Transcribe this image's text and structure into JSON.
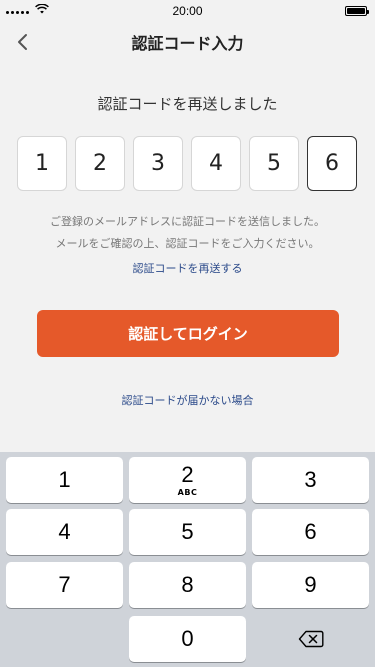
{
  "status_bar": {
    "time": "20:00"
  },
  "nav": {
    "title": "認証コード入力"
  },
  "headline": "認証コードを再送しました",
  "code_digits": [
    "1",
    "2",
    "3",
    "4",
    "5",
    "6"
  ],
  "message": {
    "line1": "ご登録のメールアドレスに認証コードを送信しました。",
    "line2": "メールをご確認の上、認証コードをご入力ください。"
  },
  "resend_link": "認証コードを再送する",
  "login_button": "認証してログイン",
  "help_link": "認証コードが届かない場合",
  "keypad": {
    "k1": "1",
    "k2": "2",
    "k2_sub": "ABC",
    "k3": "3",
    "k4": "4",
    "k5": "5",
    "k6": "6",
    "k7": "7",
    "k8": "8",
    "k9": "9",
    "k0": "0"
  },
  "colors": {
    "accent": "#e5592a",
    "link": "#2b4a8a",
    "keypad_bg": "#cfd3d9"
  },
  "icons": {
    "back": "chevron-left-icon",
    "delete": "backspace-icon"
  }
}
